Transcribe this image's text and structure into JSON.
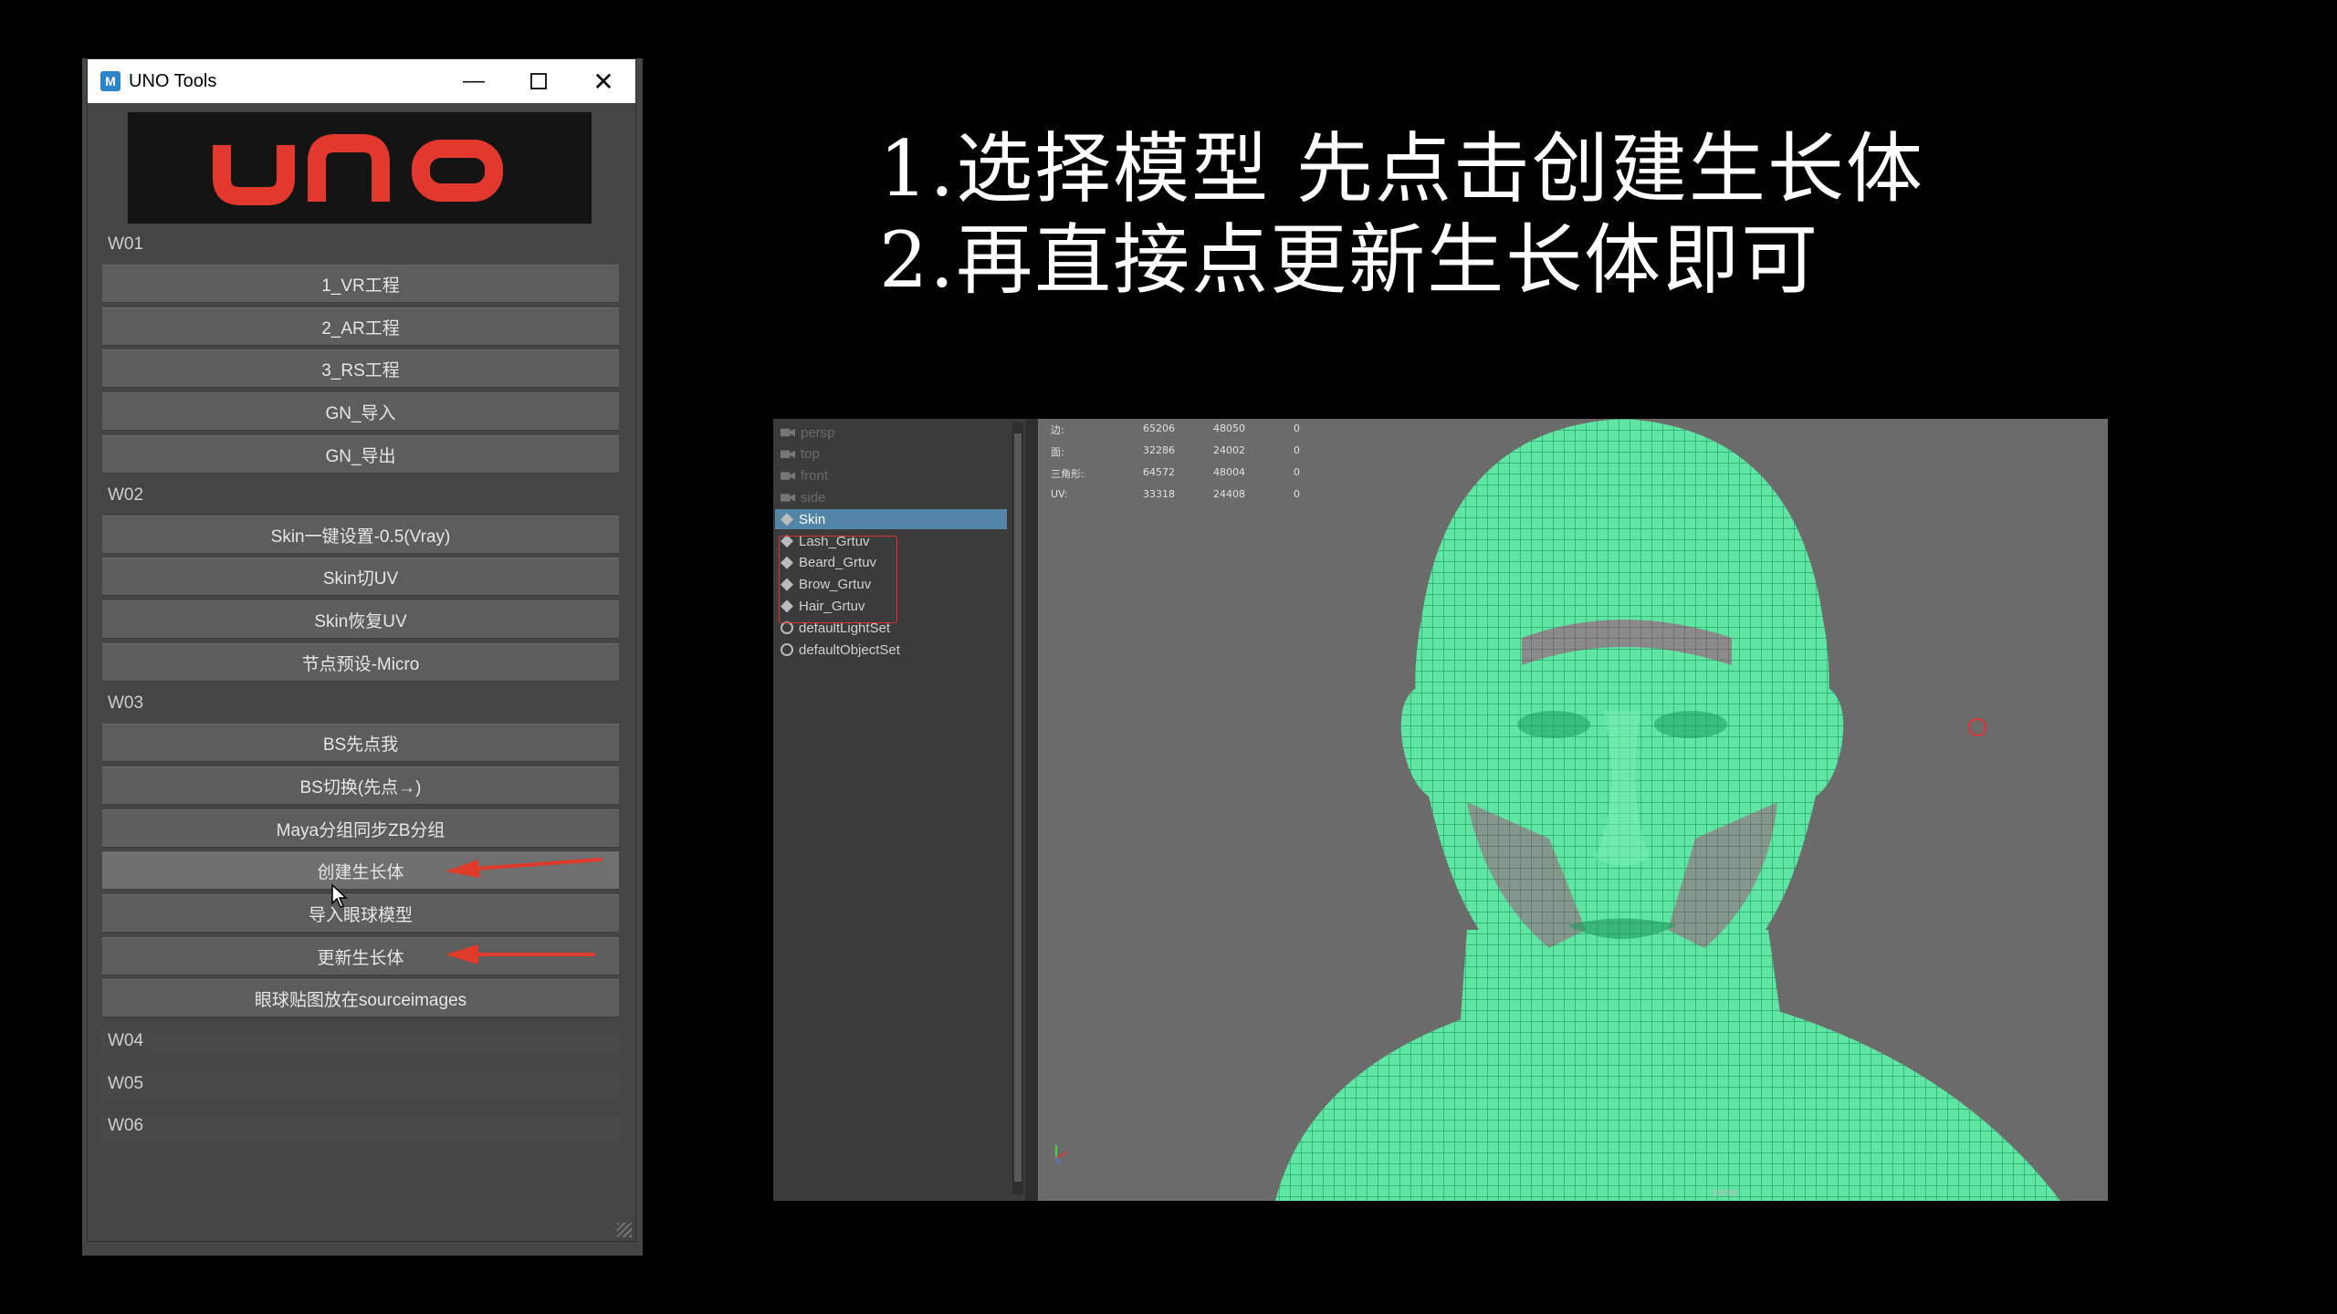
{
  "window": {
    "title": "UNO Tools",
    "minimize": "—",
    "maximize": "",
    "close": "✕",
    "logo_text": "UNO",
    "app_icon": "M"
  },
  "sections": [
    {
      "label": "W01",
      "buttons": [
        "1_VR工程",
        "2_AR工程",
        "3_RS工程",
        "GN_导入",
        "GN_导出"
      ]
    },
    {
      "label": "W02",
      "buttons": [
        "Skin一键设置-0.5(Vray)",
        "Skin切UV",
        "Skin恢复UV",
        "节点预设-Micro"
      ]
    },
    {
      "label": "W03",
      "buttons": [
        "BS先点我",
        "BS切换(先点→)",
        "Maya分组同步ZB分组",
        "创建生长体",
        "导入眼球模型",
        "更新生长体",
        "眼球贴图放在sourceimages"
      ]
    },
    {
      "label": "W04",
      "buttons": []
    },
    {
      "label": "W05",
      "buttons": []
    },
    {
      "label": "W06",
      "buttons": []
    }
  ],
  "instructions": [
    "1.选择模型 先点击创建生长体",
    "2.再直接点更新生长体即可"
  ],
  "maya": {
    "outliner": [
      {
        "label": "persp",
        "icon": "camera-icon",
        "state": "dim"
      },
      {
        "label": "top",
        "icon": "camera-icon",
        "state": "dim"
      },
      {
        "label": "front",
        "icon": "camera-icon",
        "state": "dim"
      },
      {
        "label": "side",
        "icon": "camera-icon",
        "state": "dim"
      },
      {
        "label": "Skin",
        "icon": "mesh-icon",
        "state": "selected"
      },
      {
        "label": "Lash_Grtuv",
        "icon": "mesh-icon",
        "state": "normal"
      },
      {
        "label": "Beard_Grtuv",
        "icon": "mesh-icon",
        "state": "normal"
      },
      {
        "label": "Brow_Grtuv",
        "icon": "mesh-icon",
        "state": "normal"
      },
      {
        "label": "Hair_Grtuv",
        "icon": "mesh-icon",
        "state": "normal"
      },
      {
        "label": "defaultLightSet",
        "icon": "set-icon",
        "state": "normal"
      },
      {
        "label": "defaultObjectSet",
        "icon": "set-icon",
        "state": "normal"
      }
    ],
    "hud": [
      {
        "label": "边:",
        "a": "65206",
        "b": "48050",
        "c": "0"
      },
      {
        "label": "面:",
        "a": "32286",
        "b": "24002",
        "c": "0"
      },
      {
        "label": "三角形:",
        "a": "64572",
        "b": "48004",
        "c": "0"
      },
      {
        "label": "UV:",
        "a": "33318",
        "b": "24408",
        "c": "0"
      }
    ],
    "viewport_label": "persp",
    "wire_color": "#3de08f",
    "surface_color": "#5fe6a3"
  }
}
